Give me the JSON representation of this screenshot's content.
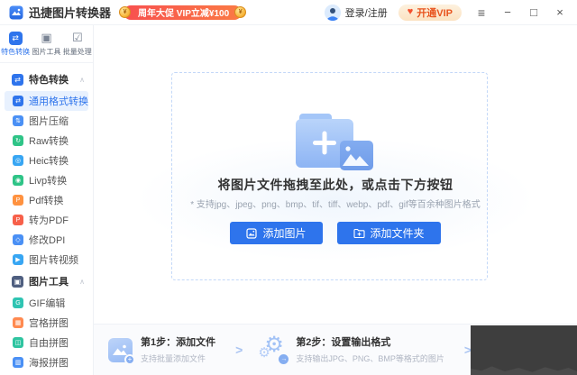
{
  "titlebar": {
    "app_title": "迅捷图片转换器",
    "promo_text": "周年大促 VIP立减¥100",
    "login_label": "登录/注册",
    "vip_label": "开通VIP"
  },
  "icons": {
    "coin": "¥",
    "vip_heart": "♥",
    "menu": "≡",
    "minimize": "−",
    "maximize": "□",
    "close": "×",
    "collapse": "∧",
    "chevron": ">"
  },
  "colors": {
    "accent_blue": "#2e74ec",
    "active_item_bg": "#e8f1fe",
    "promo_red": "#f8504f",
    "vip_orange": "#e8541e",
    "blob_dark": "#3e3e3e"
  },
  "sidebar": {
    "tabs": [
      {
        "label": "特色转换",
        "icon": "featured-convert",
        "glyph": "⇄",
        "active": true
      },
      {
        "label": "图片工具",
        "icon": "image-tools",
        "glyph": "▣",
        "active": false
      },
      {
        "label": "批量处理",
        "icon": "batch-process",
        "glyph": "☑",
        "active": false
      }
    ],
    "sections": [
      {
        "label": "特色转换",
        "items": [
          {
            "id": "universal-format-convert",
            "label": "通用格式转换",
            "glyph": "⇄",
            "color": "#2e74ec",
            "active": true
          },
          {
            "id": "image-compress",
            "label": "图片压缩",
            "glyph": "⇅",
            "color": "#4a90f5",
            "active": false
          },
          {
            "id": "raw-convert",
            "label": "Raw转换",
            "glyph": "↻",
            "color": "#2fc487",
            "active": false
          },
          {
            "id": "heic-convert",
            "label": "Heic转换",
            "glyph": "◎",
            "color": "#38a6f3",
            "active": false
          },
          {
            "id": "livp-convert",
            "label": "Livp转换",
            "glyph": "◉",
            "color": "#2fc487",
            "active": false
          },
          {
            "id": "pdf-convert",
            "label": "Pdf转换",
            "glyph": "P",
            "color": "#ff9240",
            "active": false
          },
          {
            "id": "to-pdf",
            "label": "转为PDF",
            "glyph": "P",
            "color": "#f7604a",
            "active": false
          },
          {
            "id": "modify-dpi",
            "label": "修改DPI",
            "glyph": "◇",
            "color": "#4a90f5",
            "active": false
          },
          {
            "id": "image-to-video",
            "label": "图片转视频",
            "glyph": "▶",
            "color": "#38a6f3",
            "active": false
          }
        ]
      },
      {
        "label": "图片工具",
        "items": [
          {
            "id": "gif-edit",
            "label": "GIF编辑",
            "glyph": "G",
            "color": "#2fc4b2",
            "active": false
          },
          {
            "id": "grid-collage",
            "label": "宫格拼图",
            "glyph": "▦",
            "color": "#ff8a50",
            "active": false
          },
          {
            "id": "free-collage",
            "label": "自由拼图",
            "glyph": "◫",
            "color": "#2fc4a0",
            "active": false
          },
          {
            "id": "poster-collage",
            "label": "海报拼图",
            "glyph": "▥",
            "color": "#4a90f5",
            "active": false
          }
        ]
      }
    ]
  },
  "main": {
    "heading": "将图片文件拖拽至此处，或点击下方按钮",
    "formats_note": "* 支持jpg、jpeg、png、bmp、tif、tiff、webp、pdf、gif等百余种图片格式",
    "buttons": [
      {
        "label": "添加图片"
      },
      {
        "label": "添加文件夹"
      }
    ]
  },
  "steps": [
    {
      "title": "第1步：添加文件",
      "subtitle": "支持批量添加文件"
    },
    {
      "title": "第2步：设置输出格式",
      "subtitle": "支持输出JPG、PNG、BMP等格式的图片"
    },
    {
      "title": "",
      "subtitle": ""
    }
  ]
}
